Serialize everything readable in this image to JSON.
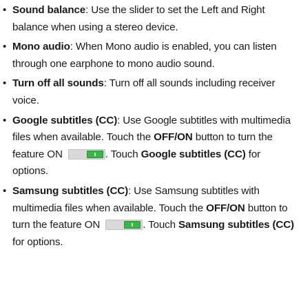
{
  "items": [
    {
      "title": "Sound balance",
      "text": ": Use the slider to set the Left and Right balance when using a stereo device."
    },
    {
      "title": "Mono audio",
      "text": ": When Mono audio is enabled, you can listen through one earphone to mono audio sound."
    },
    {
      "title": "Turn off all sounds",
      "text": ": Turn off all sounds including receiver voice."
    },
    {
      "title": "Google subtitles (CC)",
      "text1": ": Use Google subtitles with multimedia files when available. Touch the ",
      "button": "OFF/ON",
      "text2": " button to turn the feature ON ",
      "text3": ". Touch ",
      "title_repeat": "Google subtitles (CC)",
      "text4": " for options."
    },
    {
      "title": "Samsung subtitles (CC)",
      "text1": ": Use Samsung subtitles with multimedia files when available. Touch the ",
      "button": "OFF/ON",
      "text2": " button to turn the feature ON ",
      "text3": ". Touch ",
      "title_repeat": "Samsung subtitles (CC)",
      "text4": " for options."
    }
  ],
  "bullet": "•",
  "toggle_state": "ON",
  "colors": {
    "text": "#1a1a1a",
    "toggle_track": "#d9d9d9",
    "toggle_knob": "#3bb54a"
  },
  "icons": [
    "toggle-switch-on-icon"
  ]
}
